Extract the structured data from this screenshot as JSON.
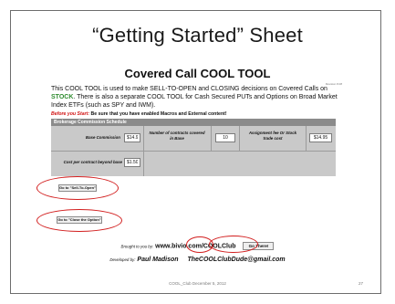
{
  "slide": {
    "title": "“Getting Started” Sheet",
    "footer_text": "COOL_Club December 5, 2012",
    "page_number": "27"
  },
  "doc": {
    "title": "Covered Call COOL TOOL",
    "version": "Revision 8.08",
    "intro": {
      "part1": "This COOL TOOL is used to make SELL-TO-OPEN and CLOSING decisions on Covered Calls on ",
      "stock": "STOCK",
      "part2": ". There is also a separate COOL TOOL for Cash Secured PUTs and Options on Broad Market Index ETFs (such as SPY and IWM)."
    },
    "warning": {
      "lead": "Before you Start:",
      "text": " Be sure that you have enabled Macros and External content!"
    }
  },
  "schedule": {
    "header": "Brokerage Commission Schedule",
    "base_commission_label": "Base Commission",
    "base_commission_value": "$14.95",
    "contracts_label": "Number of contracts covered in Base",
    "contracts_value": "10",
    "assignment_label": "Assignment fee Or Stock trade cost",
    "assignment_value": "$14.95",
    "per_contract_label": "Cost per contract beyond base",
    "per_contract_value": "$1.50"
  },
  "buttons": {
    "sell_to_open": "Go to \"Sell-To-Open\"",
    "close_option": "Go to \"Close the Option\"",
    "go_there": "Go There!"
  },
  "credits": {
    "brought_label": "Brought to you by:",
    "brought_link": "www.bivio.com/COOLClub",
    "developed_label": "Developed by:",
    "developer_name": "Paul Madison",
    "developer_email": "TheCOOLClubDude@gmail.com"
  },
  "colors": {
    "highlight_oval": "#d21e1e",
    "stock_green": "#2e8b2e",
    "warning_red": "#d01010",
    "table_header": "#8b8b8b",
    "table_body": "#c9c9c9"
  }
}
